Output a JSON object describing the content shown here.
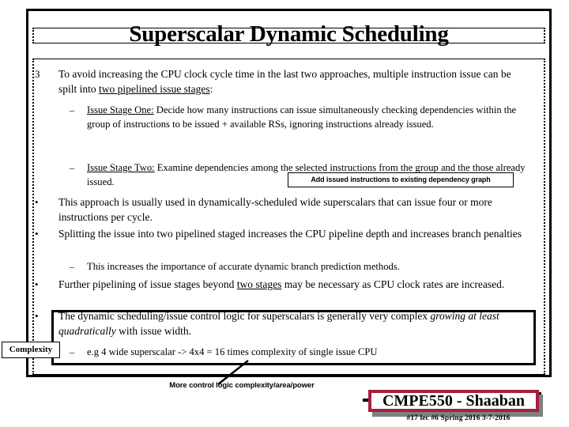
{
  "slide": {
    "title": "Superscalar Dynamic Scheduling",
    "bullets": [
      {
        "marker": "3",
        "level": 1,
        "segments": [
          {
            "text": "To avoid increasing the CPU clock cycle time in the last two approaches, multiple instruction issue can be spilt into ",
            "style": "plain"
          },
          {
            "text": "two pipelined issue stages",
            "style": "underline"
          },
          {
            "text": ":",
            "style": "plain"
          }
        ]
      },
      {
        "marker": "–",
        "level": 2,
        "segments": [
          {
            "text": "Issue Stage One:",
            "style": "underline"
          },
          {
            "text": "  Decide how many instructions can issue simultaneously checking dependencies within the group of instructions to be issued + available RSs, ignoring instructions already issued.",
            "style": "plain"
          }
        ]
      },
      {
        "marker": "–",
        "level": 2,
        "segments": [
          {
            "text": "Issue Stage Two:",
            "style": "underline"
          },
          {
            "text": "  Examine dependencies  among the selected instructions from the group and the those already issued.",
            "style": "plain"
          }
        ]
      },
      {
        "marker": "•",
        "level": 1,
        "segments": [
          {
            "text": "This approach is usually used in dynamically-scheduled  wide superscalars that can issue four or more instructions per cycle.",
            "style": "plain"
          }
        ]
      },
      {
        "marker": "•",
        "level": 1,
        "segments": [
          {
            "text": "Splitting the issue into two pipelined staged increases the CPU pipeline depth and increases branch penalties",
            "style": "plain"
          }
        ]
      },
      {
        "marker": "–",
        "level": 2,
        "segments": [
          {
            "text": "This increases the importance of accurate dynamic branch prediction methods.",
            "style": "plain"
          }
        ]
      },
      {
        "marker": "•",
        "level": 1,
        "segments": [
          {
            "text": "Further pipelining of issue stages beyond ",
            "style": "plain"
          },
          {
            "text": "two stages",
            "style": "underline"
          },
          {
            "text": " may be necessary as CPU clock rates are increased.",
            "style": "plain"
          }
        ]
      },
      {
        "marker": "•",
        "level": 1,
        "segments": [
          {
            "text": "The dynamic scheduling/issue control logic for superscalars is generally very complex ",
            "style": "plain"
          },
          {
            "text": "growing at least quadratically",
            "style": "italic"
          },
          {
            "text": " with issue width.",
            "style": "plain"
          }
        ]
      },
      {
        "marker": "–",
        "level": 2,
        "segments": [
          {
            "text": "e.g  4 wide superscalar ->  4x4 = 16 times complexity of single issue CPU",
            "style": "plain"
          }
        ]
      }
    ],
    "callout": "Add issued instructions to existing dependency graph",
    "complexity_tag": "Complexity",
    "caption": "More control logic complexity/area/power"
  },
  "footer": {
    "badge": "CMPE550 - Shaaban",
    "meta": "#17  lec #6  Spring 2016  3-7-2016",
    "badge_border_color": "#A6203C",
    "badge_shadow_color": "#808080"
  }
}
